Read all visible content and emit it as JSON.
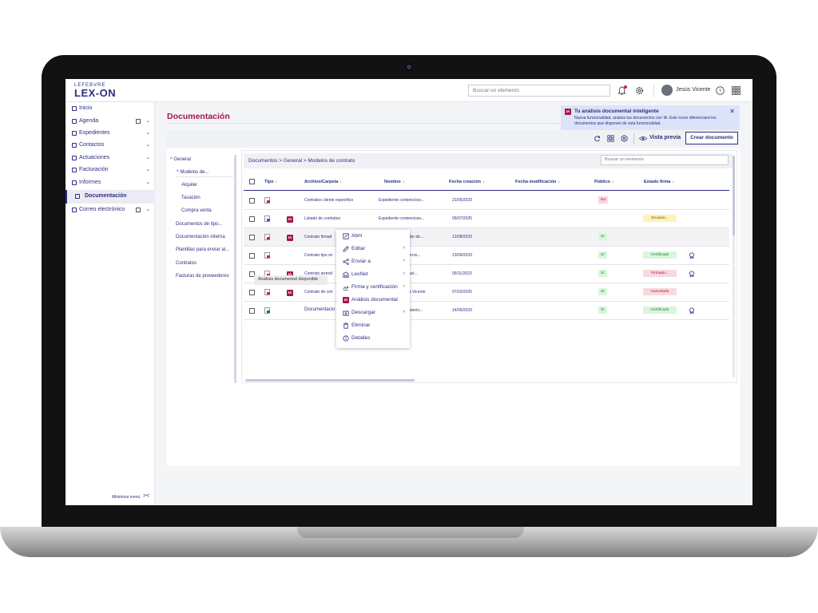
{
  "app": {
    "logo_top": "LEFEBVRE",
    "logo_main": "LEX-ON",
    "search_placeholder": "Buscar un elemento",
    "user_name": "Jesús Vicente"
  },
  "sidebar": {
    "items": [
      {
        "label": "Inicio",
        "icon": "home-icon"
      },
      {
        "label": "Agenda",
        "icon": "calendar-icon"
      },
      {
        "label": "Expedientes",
        "icon": "folder-icon"
      },
      {
        "label": "Contactos",
        "icon": "contacts-icon"
      },
      {
        "label": "Actuaciones",
        "icon": "actions-icon"
      },
      {
        "label": "Facturación",
        "icon": "billing-icon"
      },
      {
        "label": "Informes",
        "icon": "reports-icon"
      },
      {
        "label": "Documentación",
        "icon": "document-icon"
      },
      {
        "label": "Correo electrónico",
        "icon": "mail-icon"
      }
    ],
    "minimize_label": "Minimizar menú"
  },
  "page": {
    "title": "Documentación",
    "preview_label": "Vista previa",
    "create_label": "Crear documento"
  },
  "banner": {
    "badge": "IA",
    "title": "Tu análisis documental inteligente",
    "text": "Nueva funcionalidad, analiza tus documentos con IA. Este icono diferenciará los documentos que disponen de esta funcionalidad.",
    "close": "✕"
  },
  "tree": {
    "items": [
      "General",
      "Modelos de...",
      "Alquiler",
      "Tasación",
      "Compra venta",
      "Documentos de tipo...",
      "Documentación interna",
      "Plantillas para enviar al...",
      "Contratos",
      "Facturas de proveedores"
    ]
  },
  "panel": {
    "breadcrumb": "Documentos  >  General  >  Modelos de contrato",
    "search_placeholder": "Buscar un elemento",
    "columns": [
      "Tipo",
      "Archivo/Carpeta",
      "Nombre",
      "Fecha creación",
      "Fecha modificación",
      "Público",
      "Estado firma"
    ],
    "rows": [
      {
        "archivo": "Contratos cliente especifico",
        "nombre": "Expediente contencioso...",
        "fecha": "21/05/2023",
        "publico": "No",
        "estado": ""
      },
      {
        "archivo": "Listado de contratos",
        "nombre": "Expediente contencioso...",
        "fecha": "09/07/2025",
        "publico": "",
        "estado": "Enviado..."
      },
      {
        "archivo": "Contrato firmad",
        "nombre": "ador de...",
        "fecha": "12/08/2023",
        "publico": "Sí",
        "estado": ""
      },
      {
        "archivo": "Contrato tipo ve",
        "nombre": "vorcio...",
        "fecha": "13/09/2023",
        "publico": "Sí",
        "estado": "Certificado"
      },
      {
        "archivo": "Contrato arrend",
        "nombre": "nuel...",
        "fecha": "05/11/2023",
        "publico": "Sí",
        "estado": "Firmado..."
      },
      {
        "archivo": "Contrato de con",
        "nombre": "na Vicente",
        "fecha": "07/03/2025",
        "publico": "Sí",
        "estado": "Cancelado"
      },
      {
        "archivo": "Documentacio",
        "nombre": "nisterio...",
        "fecha": "14/05/2023",
        "publico": "Sí",
        "estado": "Certificado"
      }
    ]
  },
  "tooltip": "Análisis documental disponible",
  "context_menu": {
    "items": [
      {
        "label": "Abrir",
        "icon": "open-icon"
      },
      {
        "label": "Editar",
        "icon": "edit-icon"
      },
      {
        "label": "Enviar a",
        "icon": "share-icon"
      },
      {
        "label": "LexNet",
        "icon": "lexnet-icon"
      },
      {
        "label": "Firma y certificación",
        "icon": "signature-icon"
      },
      {
        "label": "Análisis documental",
        "icon": "ia-icon"
      },
      {
        "label": "Descargar",
        "icon": "download-icon"
      },
      {
        "label": "Eliminar",
        "icon": "trash-icon"
      },
      {
        "label": "Detalles",
        "icon": "info-icon"
      }
    ]
  },
  "colors": {
    "brand": "#2b2e83",
    "accent": "#a3174a",
    "pill_no": "#f7d6dc",
    "pill_si": "#d9f5dd",
    "pill_enviado": "#fdf2b8",
    "pill_cancelado": "#f8d9de",
    "pill_cert": "#d9f5dd"
  }
}
